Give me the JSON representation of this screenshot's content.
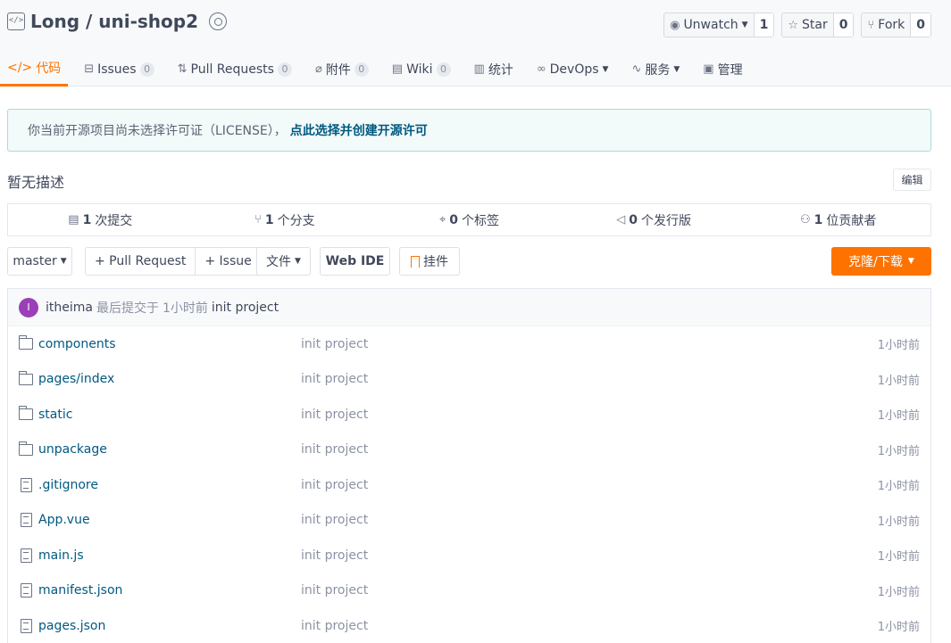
{
  "repo": {
    "title": "Long / uni-shop2"
  },
  "actions": [
    {
      "label": "Unwatch",
      "count": "1"
    },
    {
      "label": "Star",
      "count": "0"
    },
    {
      "label": "Fork",
      "count": "0"
    }
  ],
  "tabs": [
    {
      "label": "代码",
      "icon": "code-icon"
    },
    {
      "label": "Issues",
      "count": "0",
      "icon": "issues-icon"
    },
    {
      "label": "Pull Requests",
      "count": "0",
      "icon": "pull-request-icon"
    },
    {
      "label": "附件",
      "count": "0",
      "icon": "attachment-icon"
    },
    {
      "label": "Wiki",
      "count": "0",
      "icon": "wiki-icon"
    },
    {
      "label": "统计",
      "icon": "chart-icon"
    },
    {
      "label": "DevOps",
      "icon": "infinity-icon"
    },
    {
      "label": "服务",
      "icon": "pulse-icon"
    },
    {
      "label": "管理",
      "icon": "manage-icon"
    }
  ],
  "license": {
    "text": "你当前开源项目尚未选择许可证（LICENSE），",
    "link": "点此选择并创建开源许可"
  },
  "description": "暂无描述",
  "edit_label": "编辑",
  "stats": [
    {
      "num": "1",
      "label": "次提交",
      "icon": "commit-icon"
    },
    {
      "num": "1",
      "label": "个分支",
      "icon": "branch-icon"
    },
    {
      "num": "0",
      "label": "个标签",
      "icon": "tag-icon"
    },
    {
      "num": "0",
      "label": "个发行版",
      "icon": "release-icon"
    },
    {
      "num": "1",
      "label": "位贡献者",
      "icon": "contributors-icon"
    }
  ],
  "toolbar": {
    "branch": "master",
    "pull_request": "+ Pull Request",
    "issue": "+ Issue",
    "files": "文件",
    "web_ide": "Web IDE",
    "plugin": "挂件",
    "clone": "克隆/下载"
  },
  "commit": {
    "avatar_letter": "I",
    "author": "itheima",
    "text": "最后提交于",
    "time": "1小时前",
    "message": "init project"
  },
  "files": [
    {
      "name": "components",
      "type": "folder",
      "message": "init project",
      "time": "1小时前"
    },
    {
      "name": "pages/index",
      "type": "folder",
      "message": "init project",
      "time": "1小时前"
    },
    {
      "name": "static",
      "type": "folder",
      "message": "init project",
      "time": "1小时前"
    },
    {
      "name": "unpackage",
      "type": "folder",
      "message": "init project",
      "time": "1小时前"
    },
    {
      "name": ".gitignore",
      "type": "file",
      "message": "init project",
      "time": "1小时前"
    },
    {
      "name": "App.vue",
      "type": "file",
      "message": "init project",
      "time": "1小时前"
    },
    {
      "name": "main.js",
      "type": "file",
      "message": "init project",
      "time": "1小时前"
    },
    {
      "name": "manifest.json",
      "type": "file",
      "message": "init project",
      "time": "1小时前"
    },
    {
      "name": "pages.json",
      "type": "file",
      "message": "init project",
      "time": "1小时前"
    }
  ],
  "colors": {
    "accent": "#fe7300",
    "link": "#005980",
    "avatar": "#9b3fb8"
  }
}
